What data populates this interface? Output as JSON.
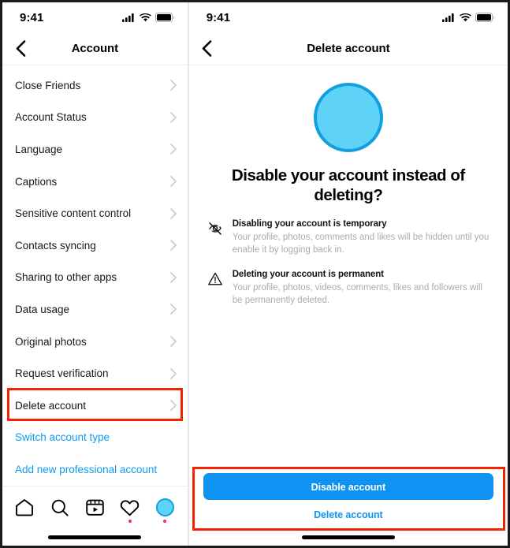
{
  "colors": {
    "accent_blue": "#0f93f2",
    "link_blue": "#0f9bf2",
    "highlight_red": "#f42200",
    "avatar_fill": "#5fd3f7",
    "avatar_ring": "#119fe0",
    "muted_text": "#a9acb0",
    "badge_red": "#ff2d4b"
  },
  "left_panel": {
    "status_bar": {
      "time": "9:41",
      "icons": [
        "cellular-signal-icon",
        "wifi-icon",
        "battery-icon"
      ]
    },
    "nav": {
      "back_icon": "chevron-left-icon",
      "title": "Account"
    },
    "list_items": [
      {
        "label": "Close Friends",
        "type": "row",
        "chevron": "chevron-right-icon"
      },
      {
        "label": "Account Status",
        "type": "row",
        "chevron": "chevron-right-icon"
      },
      {
        "label": "Language",
        "type": "row",
        "chevron": "chevron-right-icon"
      },
      {
        "label": "Captions",
        "type": "row",
        "chevron": "chevron-right-icon"
      },
      {
        "label": "Sensitive content control",
        "type": "row",
        "chevron": "chevron-right-icon"
      },
      {
        "label": "Contacts syncing",
        "type": "row",
        "chevron": "chevron-right-icon"
      },
      {
        "label": "Sharing to other apps",
        "type": "row",
        "chevron": "chevron-right-icon"
      },
      {
        "label": "Data usage",
        "type": "row",
        "chevron": "chevron-right-icon"
      },
      {
        "label": "Original photos",
        "type": "row",
        "chevron": "chevron-right-icon"
      },
      {
        "label": "Request verification",
        "type": "row",
        "chevron": "chevron-right-icon"
      },
      {
        "label": "Delete account",
        "type": "row",
        "chevron": "chevron-right-icon",
        "highlighted": true
      },
      {
        "label": "Switch account type",
        "type": "link"
      },
      {
        "label": "Add new professional account",
        "type": "link"
      }
    ],
    "tabbar": [
      {
        "name": "home-icon",
        "badge": false
      },
      {
        "name": "search-icon",
        "badge": false
      },
      {
        "name": "reels-icon",
        "badge": false
      },
      {
        "name": "heart-icon",
        "badge": true
      },
      {
        "name": "profile-avatar",
        "badge": true
      }
    ]
  },
  "right_panel": {
    "status_bar": {
      "time": "9:41",
      "icons": [
        "cellular-signal-icon",
        "wifi-icon",
        "battery-icon"
      ]
    },
    "nav": {
      "back_icon": "chevron-left-icon",
      "title": "Delete account"
    },
    "avatar": "profile-avatar",
    "heading": "Disable your account instead of deleting?",
    "info_items": [
      {
        "icon": "eye-slash-icon",
        "title": "Disabling your account is temporary",
        "desc": "Your profile, photos, comments and likes will be hidden until you enable it by logging back in."
      },
      {
        "icon": "warning-triangle-icon",
        "title": "Deleting your account is permanent",
        "desc": "Your profile, photos, videos, comments, likes and followers will be permanently deleted."
      }
    ],
    "actions": {
      "primary_label": "Disable account",
      "secondary_label": "Delete account",
      "highlighted": true
    }
  }
}
